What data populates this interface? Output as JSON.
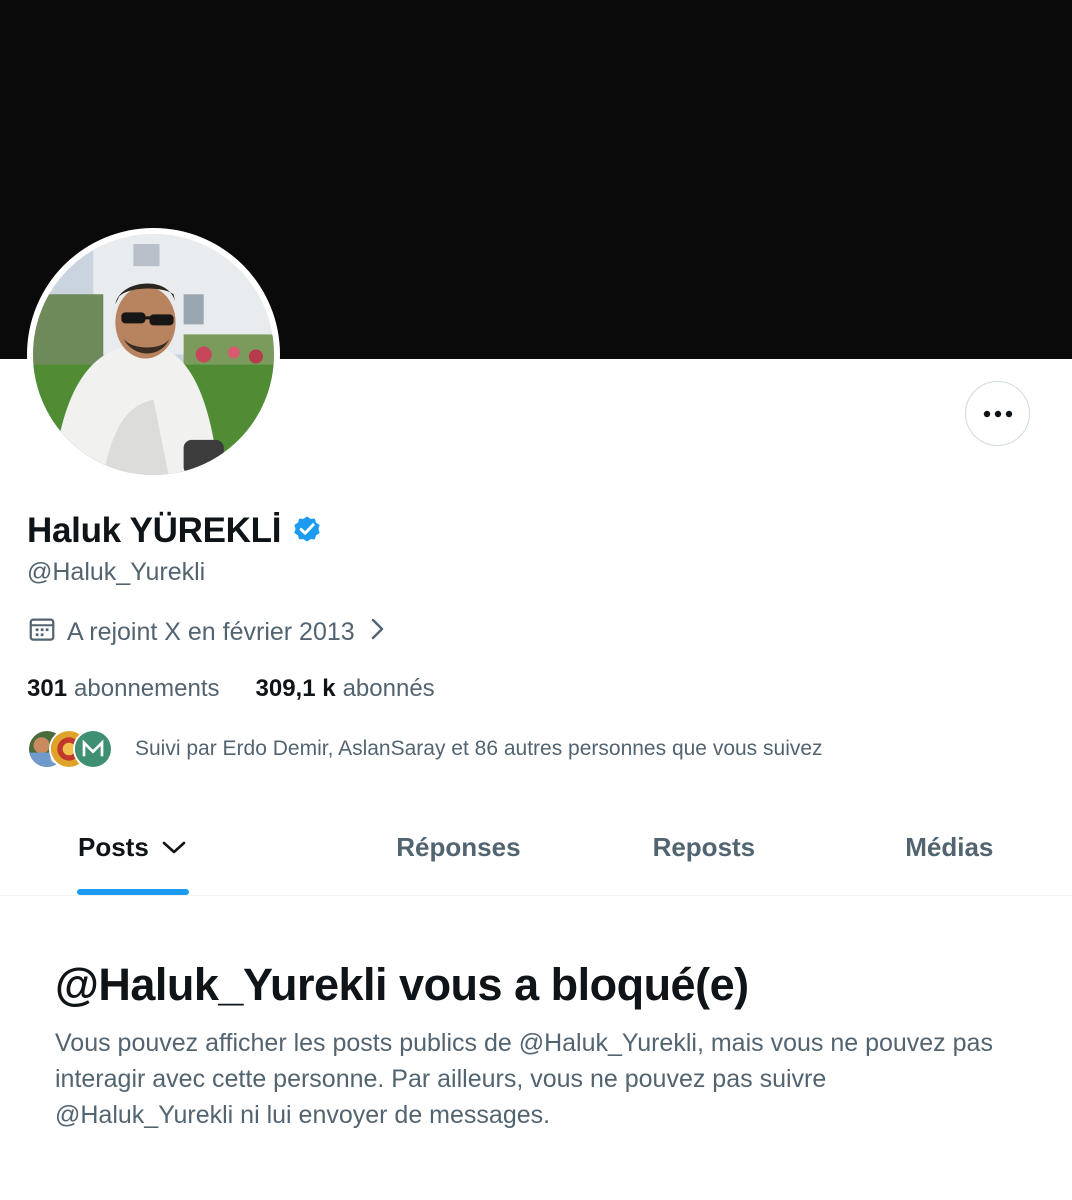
{
  "profile": {
    "display_name": "Haluk YÜREKLİ",
    "handle": "@Haluk_Yurekli",
    "joined": "A rejoint X en février 2013",
    "following_count": "301",
    "following_label": "abonnements",
    "followers_count": "309,1 k",
    "followers_label": "abonnés",
    "followed_by_text": "Suivi par Erdo Demir, AslanSaray et 86 autres personnes que vous suivez"
  },
  "tabs": [
    {
      "label": "Posts"
    },
    {
      "label": "Réponses"
    },
    {
      "label": "Reposts"
    },
    {
      "label": "Médias"
    }
  ],
  "blocked_notice": {
    "title": "@Haluk_Yurekli vous a bloqué(e)",
    "description": "Vous pouvez afficher les posts publics de @Haluk_Yurekli, mais vous ne pouvez pas interagir avec cette personne. Par ailleurs, vous ne pouvez pas suivre @Haluk_Yurekli ni lui envoyer de messages."
  },
  "colors": {
    "banner": "#0b0a0b",
    "accent": "#1d9bf0",
    "verified": "#1d9bf0",
    "secondary_text": "#536471"
  },
  "icons": {
    "more": "more-horizontal-icon",
    "verified": "verified-badge-icon",
    "calendar": "calendar-icon",
    "chevron_right": "chevron-right-icon",
    "tab_dropdown": "chevron-down-icon"
  }
}
